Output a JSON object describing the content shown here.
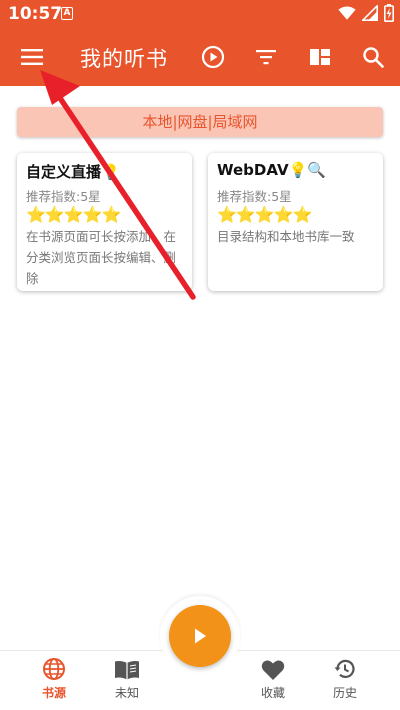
{
  "status_bar": {
    "time": "10:57",
    "notification_glyph": "A",
    "icons": [
      "wifi-icon",
      "signal-icon",
      "battery-charging-icon"
    ]
  },
  "app_bar": {
    "title": "我的听书",
    "icons": [
      "menu-icon",
      "play-circle-icon",
      "filter-icon",
      "grid-layout-icon",
      "search-icon"
    ]
  },
  "category_bar": {
    "label": "本地|网盘|局域网"
  },
  "cards": [
    {
      "title": "自定义直播💡",
      "rating": "推荐指数:5星",
      "stars": "⭐⭐⭐⭐⭐",
      "description": "在书源页面可长按添加，在分类浏览页面长按编辑、删除"
    },
    {
      "title": "WebDAV💡🔍",
      "rating": "推荐指数:5星",
      "stars": "⭐⭐⭐⭐⭐",
      "description": "目录结构和本地书库一致"
    }
  ],
  "bottom_nav": {
    "items": [
      {
        "label": "书源",
        "icon": "globe-icon",
        "active": true
      },
      {
        "label": "未知",
        "icon": "open-book-icon",
        "active": false
      },
      {
        "label": "收藏",
        "icon": "heart-icon",
        "active": false
      },
      {
        "label": "历史",
        "icon": "history-icon",
        "active": false
      }
    ],
    "fab_icon": "play-icon"
  },
  "colors": {
    "primary": "#e8542c",
    "category_bg": "#fbc5b6",
    "fab": "#f39218",
    "annotation_arrow": "#e8202a"
  }
}
